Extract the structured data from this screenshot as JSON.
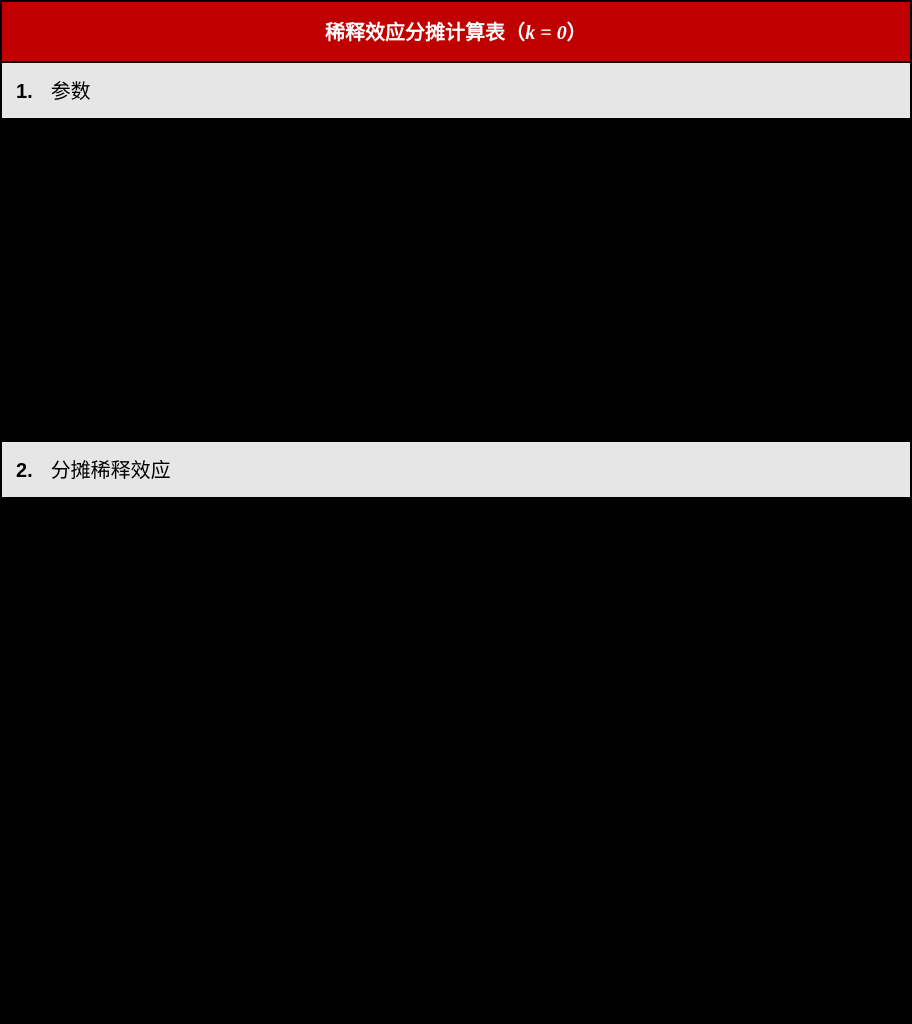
{
  "header": {
    "title_prefix": "稀释效应分摊计算表（",
    "formula_var": "k",
    "formula_eq": " = 0",
    "title_suffix": "）"
  },
  "sections": [
    {
      "number": "1.",
      "title": "参数"
    },
    {
      "number": "2.",
      "title": "分摊稀释效应"
    }
  ]
}
